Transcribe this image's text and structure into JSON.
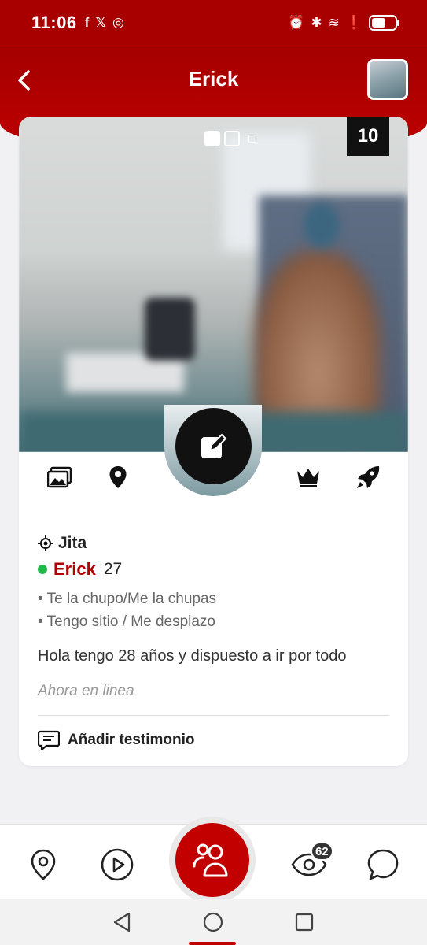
{
  "status_bar": {
    "time": "11:06",
    "left_icons": [
      "facebook-icon",
      "x-icon",
      "instagram-icon"
    ],
    "right_icons": [
      "alarm-icon",
      "bluetooth-icon",
      "wifi-icon",
      "alert-icon",
      "battery-icon"
    ],
    "battery_level": 0.6
  },
  "header": {
    "title": "Erick",
    "back_icon": "chevron-left-icon"
  },
  "profile_card": {
    "photo_count": "10",
    "photo_pages": 3,
    "active_photo": 0,
    "actions": [
      "photos-icon",
      "location-pin-icon",
      "edit-icon",
      "crown-icon",
      "rocket-icon"
    ]
  },
  "info": {
    "location": "Jita",
    "name": "Erick",
    "age": "27",
    "tags": [
      "Te la chupo/Me la chupas",
      "Tengo sitio / Me desplazo"
    ],
    "description": "Hola tengo 28 años y dispuesto a ir por todo",
    "last_seen": "Ahora en linea",
    "testimonial_label": "Añadir testimonio"
  },
  "bottom_nav": {
    "items": [
      "map-pin-icon",
      "play-icon",
      "people-icon",
      "eye-icon",
      "chat-icon"
    ],
    "viewers_badge": "62"
  },
  "colors": {
    "brand_red": "#b10000",
    "online_green": "#22b84a"
  }
}
